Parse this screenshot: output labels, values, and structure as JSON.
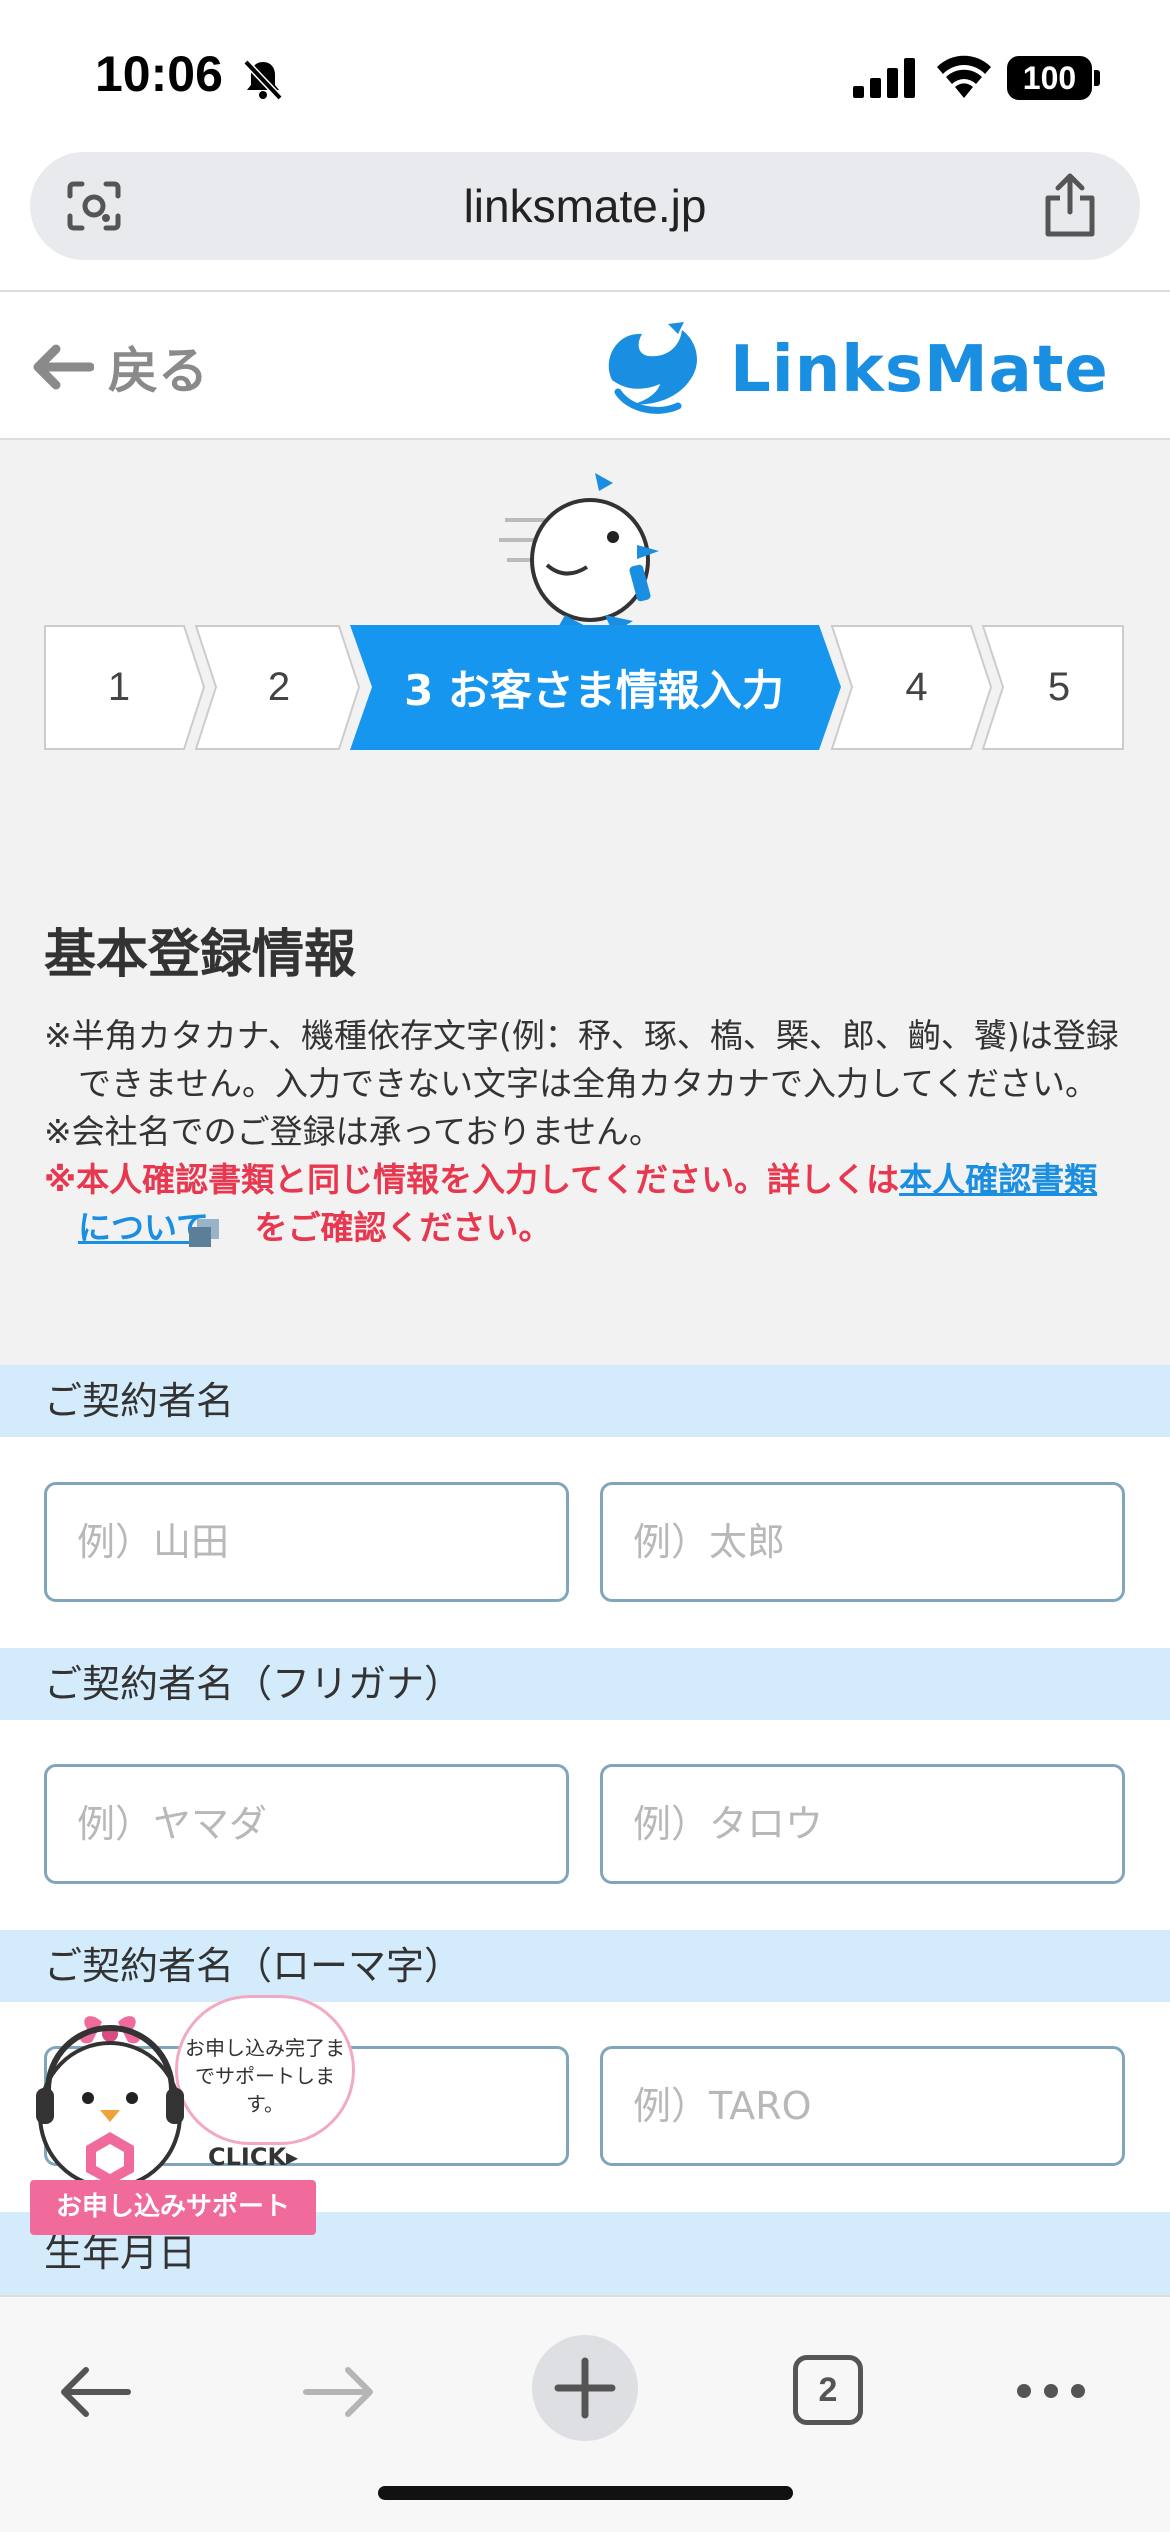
{
  "status_bar": {
    "time": "10:06",
    "battery": "100"
  },
  "browser": {
    "url": "linksmate.jp",
    "tab_count": "2"
  },
  "header": {
    "back_label": "戻る",
    "logo_text": "LinksMate",
    "brand_color": "#1a8ee0"
  },
  "steps": [
    {
      "label": "1"
    },
    {
      "label": "2"
    },
    {
      "label": "3  お客さま情報入力",
      "active": true
    },
    {
      "label": "4"
    },
    {
      "label": "5"
    }
  ],
  "section": {
    "title": "基本登録情報",
    "note1": "※半角カタカナ、機種依存文字(例：𥝱、琢、槗、㮣、郎、齣、饕)は登録できません。入力できない文字は全角カタカナで入力してください。",
    "note2": "※会社名でのご登録は承っておりません。",
    "note3_prefix": "※本人確認書類と同じ情報を入力してください。詳しくは",
    "note3_link": "本人確認書類について",
    "note3_suffix": "をご確認ください。"
  },
  "form": {
    "name": {
      "label": "ご契約者名",
      "last_placeholder": "例）山田",
      "first_placeholder": "例）太郎"
    },
    "kana": {
      "label": "ご契約者名（フリガナ）",
      "last_placeholder": "例）ヤマダ",
      "first_placeholder": "例）タロウ"
    },
    "roman": {
      "label": "ご契約者名（ローマ字）",
      "first_placeholder": "例）TARO"
    },
    "birth": {
      "label": "生年月日"
    }
  },
  "support_widget": {
    "bubble_text": "お申し込み完了までサポートします。",
    "click_label": "CLICK▸",
    "bar_label": "お申し込みサポート"
  },
  "colors": {
    "accent": "#1796ef",
    "label_band": "#d3ebfb",
    "warning": "#e8384f",
    "support_pink": "#f06a9b"
  }
}
